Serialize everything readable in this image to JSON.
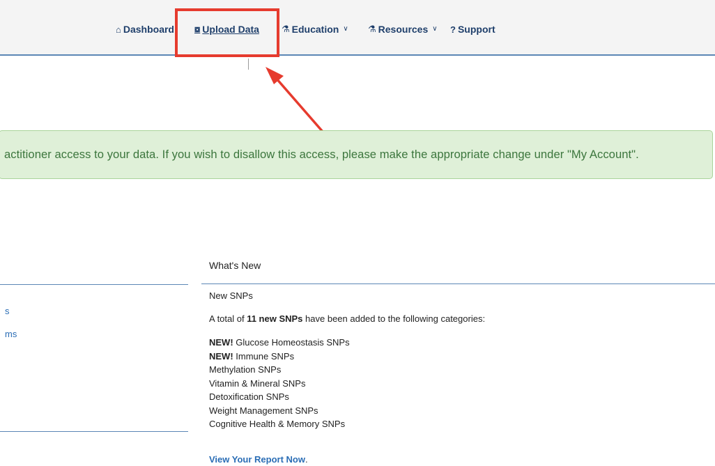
{
  "nav": {
    "dashboard": {
      "icon": "home-icon",
      "label": "Dashboard"
    },
    "upload": {
      "icon": "upload-icon",
      "label": "Upload Data"
    },
    "education": {
      "icon": "flask-icon",
      "label": "Education"
    },
    "resources": {
      "icon": "flask-icon",
      "label": "Resources"
    },
    "support": {
      "icon": "question-icon",
      "label": "Support"
    }
  },
  "annotation": {
    "color": "#e63b2e"
  },
  "alert": {
    "text": "actitioner access to your data. If you wish to disallow this access, please make the appropriate change under \"My Account\"."
  },
  "left_panel": {
    "links": [
      "s",
      "ms"
    ]
  },
  "whats_new": {
    "heading": "What's New",
    "subheading": "New SNPs",
    "intro_prefix": "A total of ",
    "intro_bold": "11 new SNPs",
    "intro_suffix": " have been added to the following categories:",
    "items": [
      {
        "new": "NEW!",
        "label": " Glucose Homeostasis SNPs"
      },
      {
        "new": "NEW!",
        "label": " Immune SNPs"
      },
      {
        "new": "",
        "label": "Methylation SNPs"
      },
      {
        "new": "",
        "label": "Vitamin & Mineral SNPs"
      },
      {
        "new": "",
        "label": "Detoxification SNPs"
      },
      {
        "new": "",
        "label": "Weight Management SNPs"
      },
      {
        "new": "",
        "label": "Cognitive Health & Memory SNPs"
      }
    ],
    "report_link": "View Your Report Now",
    "report_suffix": "."
  },
  "colors": {
    "nav_text": "#1f3f6b",
    "accent_rule": "#5b86b5",
    "alert_bg": "#dff0d8",
    "alert_text": "#3c763d",
    "link": "#2a6db5"
  }
}
